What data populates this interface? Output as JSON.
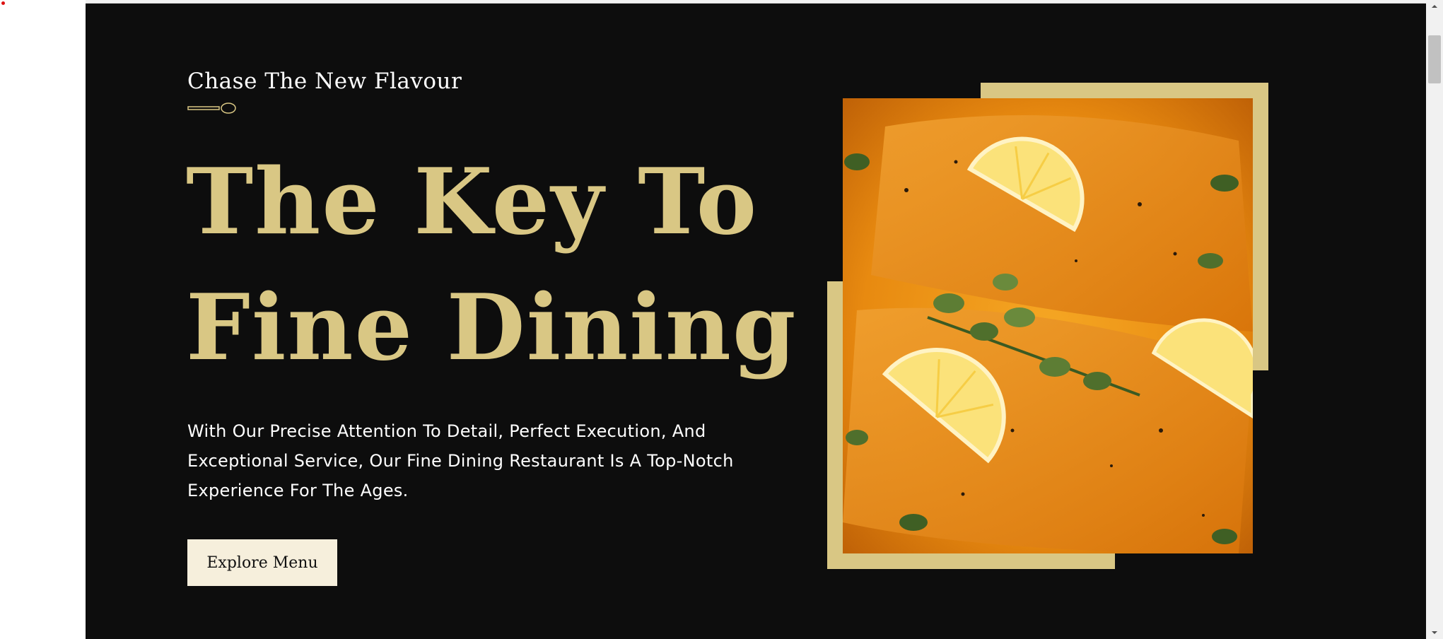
{
  "hero": {
    "eyebrow": "Chase The New Flavour",
    "title_line_1": "The Key To",
    "title_line_2": "Fine Dining",
    "description": "With Our Precise Attention To Detail, Perfect Execution, And Exceptional Service, Our Fine Dining Restaurant Is A Top-Notch Experience For The Ages.",
    "cta_label": "Explore Menu"
  },
  "image": {
    "alt": "Salmon fillets in orange sauce with lemon slices and herbs"
  },
  "icons": {
    "divider": "spoon-icon",
    "scroll_up": "chevron-up-icon",
    "scroll_down": "chevron-down-icon"
  },
  "colors": {
    "background": "#0d0d0d",
    "accent_gold": "#d9c784",
    "button_bg": "#f6efdc",
    "text_light": "#ffffff"
  }
}
